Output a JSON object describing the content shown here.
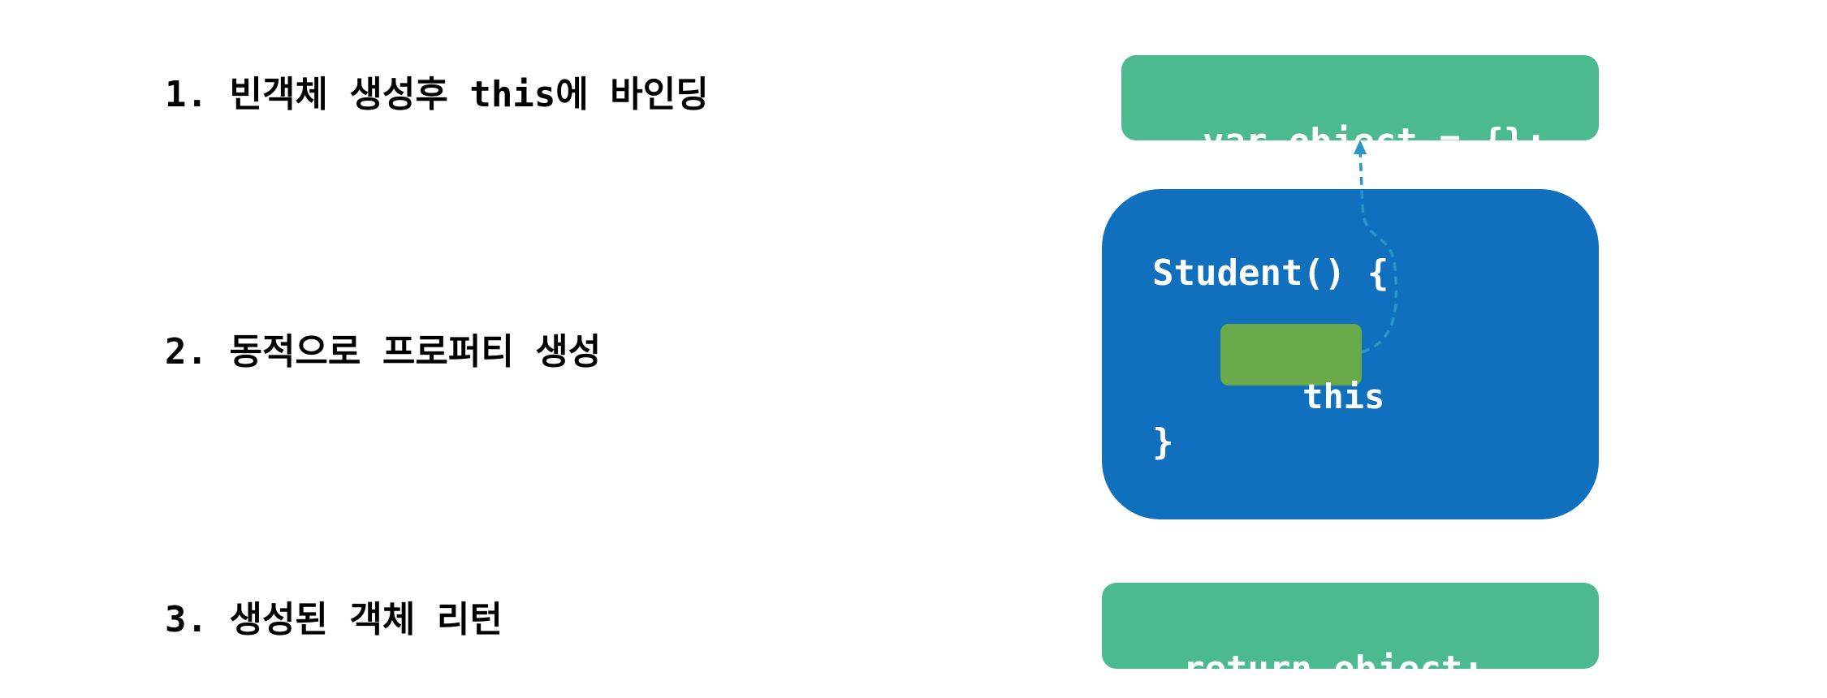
{
  "steps": [
    {
      "label": "1. 빈객체 생성후 this에 바인딩"
    },
    {
      "label": "2. 동적으로 프로퍼티 생성"
    },
    {
      "label": "3. 생성된 객체 리턴"
    }
  ],
  "code": {
    "var_object": "var object = {};",
    "func_open": "Student() {",
    "this_keyword": "this",
    "func_close": "}",
    "return_object": "return object;"
  },
  "colors": {
    "teal_box": "#4BBB8F",
    "blue_box": "#1170BD",
    "green_box": "#6AAA4A",
    "arrow": "#2A95C9"
  },
  "icons": {
    "binding_arrow": "dashed-arrow-up-icon"
  }
}
